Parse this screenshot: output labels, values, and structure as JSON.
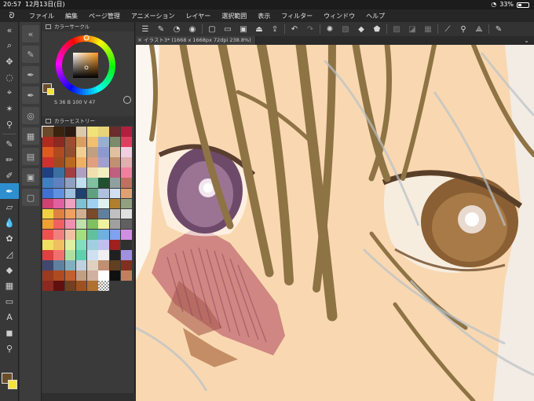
{
  "status_bar": {
    "time": "20:57",
    "date": "12月13日(日)",
    "battery": "33%",
    "battery_level": 0.33
  },
  "menu": {
    "items": [
      "ファイル",
      "編集",
      "ページ管理",
      "アニメーション",
      "レイヤー",
      "選択範囲",
      "表示",
      "フィルター",
      "ウィンドウ",
      "ヘルプ"
    ]
  },
  "tools": {
    "active_index": 11,
    "foreground_color": "#6b4d2b",
    "background_color": "#f5e23b"
  },
  "color_panel": {
    "title": "カラーサークル",
    "s_value": "36",
    "b_value": "100",
    "v_value": "47",
    "current_color": "#6b4d2b",
    "sub_color": "#f5e23b"
  },
  "history_panel": {
    "title": "カラーヒストリー",
    "swatches": [
      "#6a4a2a",
      "#3a2410",
      "#2b1b10",
      "#dcc9a8",
      "#f1e27a",
      "#e8d27a",
      "#6a2c2c",
      "#b02040",
      "#b02a20",
      "#8b2a20",
      "#9a5030",
      "#d8a060",
      "#f0c070",
      "#98b0d0",
      "#7a8a6a",
      "#e04060",
      "#e05a20",
      "#b04a20",
      "#905030",
      "#f0d090",
      "#c0a080",
      "#8a9ad0",
      "#e0c0a0",
      "#f0d0e0",
      "#d03030",
      "#a04a20",
      "#b86a20",
      "#f0b060",
      "#e0a080",
      "#a0a0d0",
      "#c09070",
      "#e0b0b0",
      "#204080",
      "#3a70a0",
      "#a04040",
      "#b0a0c0",
      "#f0e0b0",
      "#f0f0c0",
      "#c06080",
      "#f080a0",
      "#4080c0",
      "#6080c0",
      "#90a0c0",
      "#c0e0f0",
      "#80c0a0",
      "#205030",
      "#90a0a0",
      "#c07060",
      "#4070d0",
      "#6090e0",
      "#a0c0e0",
      "#204070",
      "#60a080",
      "#b0c0e0",
      "#d0e0f0",
      "#e0a070",
      "#d04070",
      "#e060a0",
      "#f0a0c0",
      "#80c0d0",
      "#a0d0f0",
      "#e0f0f0",
      "#b08030",
      "#90a080",
      "#f0d040",
      "#e08040",
      "#f0a060",
      "#d0b090",
      "#7a4a2a",
      "#6080a0",
      "#c0c0c0",
      "#e0e0e0",
      "#f0a030",
      "#f06060",
      "#f090b0",
      "#c0e0b0",
      "#80c060",
      "#f0f0a0",
      "#a0a0a0",
      "#606060",
      "#f05050",
      "#f08080",
      "#f0c0a0",
      "#a0e080",
      "#60c0a0",
      "#70b0e0",
      "#80a0f0",
      "#d090e0",
      "#f0e060",
      "#f0c060",
      "#e0f0a0",
      "#80e0c0",
      "#a0d0e0",
      "#c0c0f0",
      "#a02020",
      "#303030",
      "#e04040",
      "#f07070",
      "#b0e0a0",
      "#60d0b0",
      "#d0e0f0",
      "#f0f0f0",
      "#202020",
      "#a090e0",
      "#404870",
      "#6080a0",
      "#80b0c0",
      "#c0d0e0",
      "#e0d0c0",
      "#c09070",
      "#604020",
      "#803020",
      "#9a3a20",
      "#b04a20",
      "#c06030",
      "#c0a080",
      "#d0b0a0",
      "#ffffff",
      "#101010",
      "#c08060",
      "#8a2a20",
      "#601010",
      "#704020",
      "#a05020",
      "#b07030",
      "checker",
      "",
      ""
    ]
  },
  "canvas": {
    "tab_label": "イラスト3* (1668 x 1668px 72dpi 238.8%)"
  }
}
